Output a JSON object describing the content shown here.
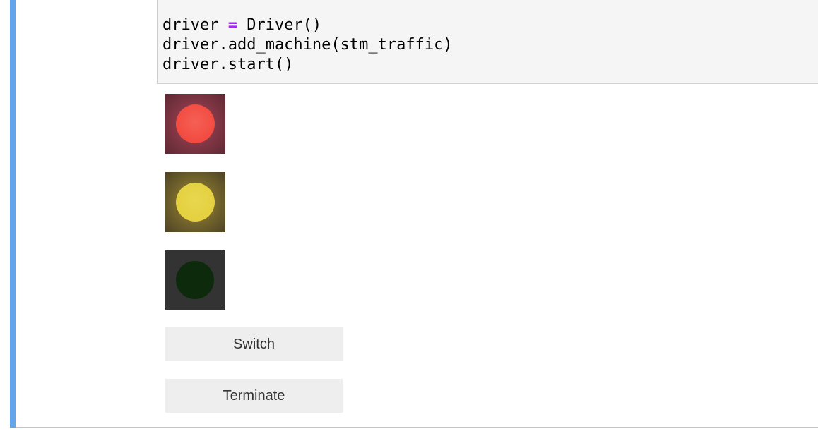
{
  "code": {
    "line1_pre": "driver ",
    "line1_op": "=",
    "line1_post": " Driver()",
    "line2": "driver.add_machine(stm_traffic)",
    "line3": "driver.start()"
  },
  "lights": {
    "red": {
      "state": "on",
      "color": "#f24a40"
    },
    "yellow": {
      "state": "on",
      "color": "#e4d040"
    },
    "green": {
      "state": "off",
      "color": "#0d2a0d"
    }
  },
  "buttons": {
    "switch_label": "Switch",
    "terminate_label": "Terminate"
  },
  "colors": {
    "cell_selected_bar": "#64a6ec",
    "code_background": "#f5f5f5",
    "operator": "#aa22ff"
  }
}
